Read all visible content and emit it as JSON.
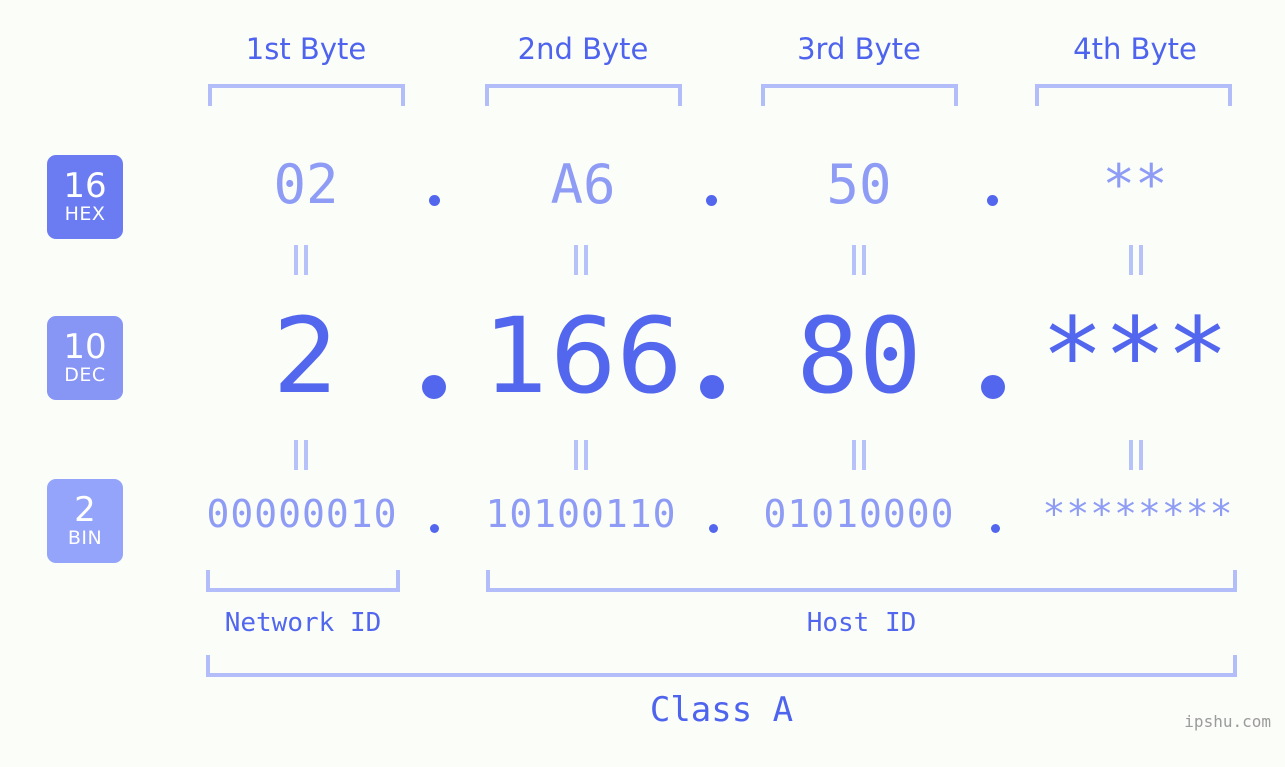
{
  "page": {
    "background_color": "#fbfdf8",
    "accent_color": "#5367ee",
    "accent_light_color": "#8e9cf5",
    "bracket_color": "#b3bdfa"
  },
  "byte_headers": [
    {
      "label": "1st Byte"
    },
    {
      "label": "2nd Byte"
    },
    {
      "label": "3rd Byte"
    },
    {
      "label": "4th Byte"
    }
  ],
  "radix_badges": [
    {
      "number": "16",
      "name": "HEX",
      "color": "#6b7cf2"
    },
    {
      "number": "10",
      "name": "DEC",
      "color": "#8795f5"
    },
    {
      "number": "2",
      "name": "BIN",
      "color": "#93a4fa"
    }
  ],
  "rows": {
    "hex": {
      "values": [
        "02",
        "A6",
        "50",
        "**"
      ]
    },
    "dec": {
      "values": [
        "2",
        "166",
        "80",
        "***"
      ]
    },
    "bin": {
      "values": [
        "00000010",
        "10100110",
        "01010000",
        "********"
      ]
    }
  },
  "separators": {
    "dot": ".",
    "equals": "="
  },
  "segments": {
    "network_id": "Network ID",
    "host_id": "Host ID",
    "class": "Class A"
  },
  "watermark": "ipshu.com"
}
